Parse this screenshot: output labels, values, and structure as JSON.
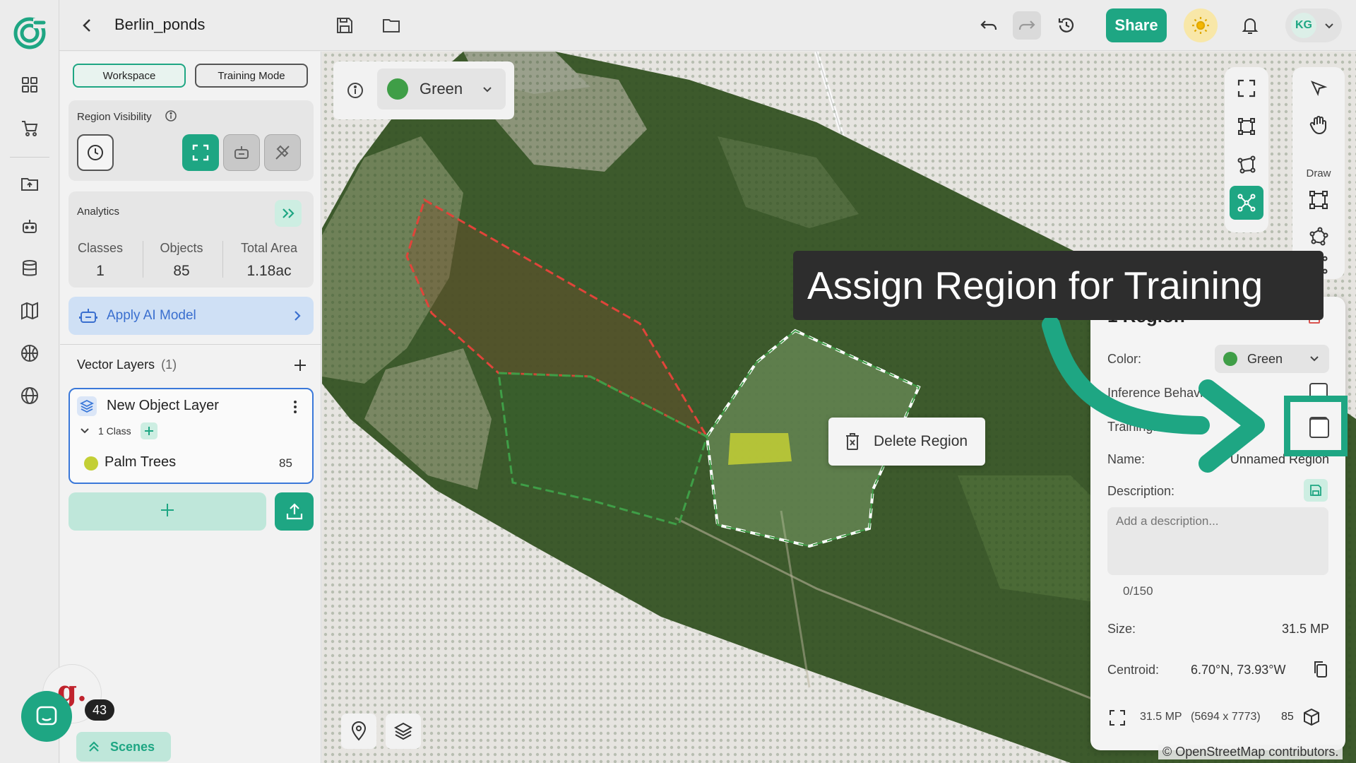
{
  "topbar": {
    "back_icon": "chevron-left-icon",
    "title": "Berlin_ponds",
    "share_label": "Share",
    "user_initials": "KG"
  },
  "rail": {
    "items": [
      "dashboard-icon",
      "cart-icon",
      "folder-icon",
      "robot-icon",
      "database-icon",
      "map-icon",
      "basketball-icon",
      "globe-icon"
    ]
  },
  "left_panel": {
    "workspace_label": "Workspace",
    "training_mode_label": "Training Mode",
    "region_visibility_label": "Region Visibility",
    "analytics": {
      "title": "Analytics",
      "classes_label": "Classes",
      "classes_value": "1",
      "objects_label": "Objects",
      "objects_value": "85",
      "area_label": "Total Area",
      "area_value": "1.18ac"
    },
    "apply_ai_label": "Apply AI Model",
    "vector_layers_label": "Vector Layers",
    "vector_layers_count": "(1)",
    "layer": {
      "name": "New Object Layer",
      "class_count_label": "1 Class",
      "class_name": "Palm Trees",
      "class_count": "85",
      "class_color": "#c3cf35"
    }
  },
  "map": {
    "color_select": "Green",
    "color_hex": "#3f9e47",
    "delete_region_label": "Delete Region",
    "draw_label": "Draw",
    "attribution": "© OpenStreetMap contributors."
  },
  "region_panel": {
    "title": "1 Region",
    "color_label": "Color:",
    "color_value": "Green",
    "inference_label": "Inference Behavior:",
    "training_label": "Training:",
    "name_label": "Name:",
    "name_value": "Unnamed Region",
    "description_label": "Description:",
    "description_placeholder": "Add a description...",
    "char_count": "0/150",
    "size_label": "Size:",
    "size_value": "31.5 MP",
    "centroid_label": "Centroid:",
    "centroid_value": "6.70°N, 73.93°W",
    "footer_mp": "31.5 MP",
    "footer_dims": "(5694 x 7773)",
    "footer_count": "85"
  },
  "overlay": {
    "tooltip": "Assign Region for Training"
  },
  "help": {
    "badge": "43",
    "scenes_label": "Scenes"
  },
  "colors": {
    "accent": "#1ea683",
    "region_green": "#3f9e47",
    "region_red": "#e0443a",
    "layer_border": "#3a78d9"
  }
}
